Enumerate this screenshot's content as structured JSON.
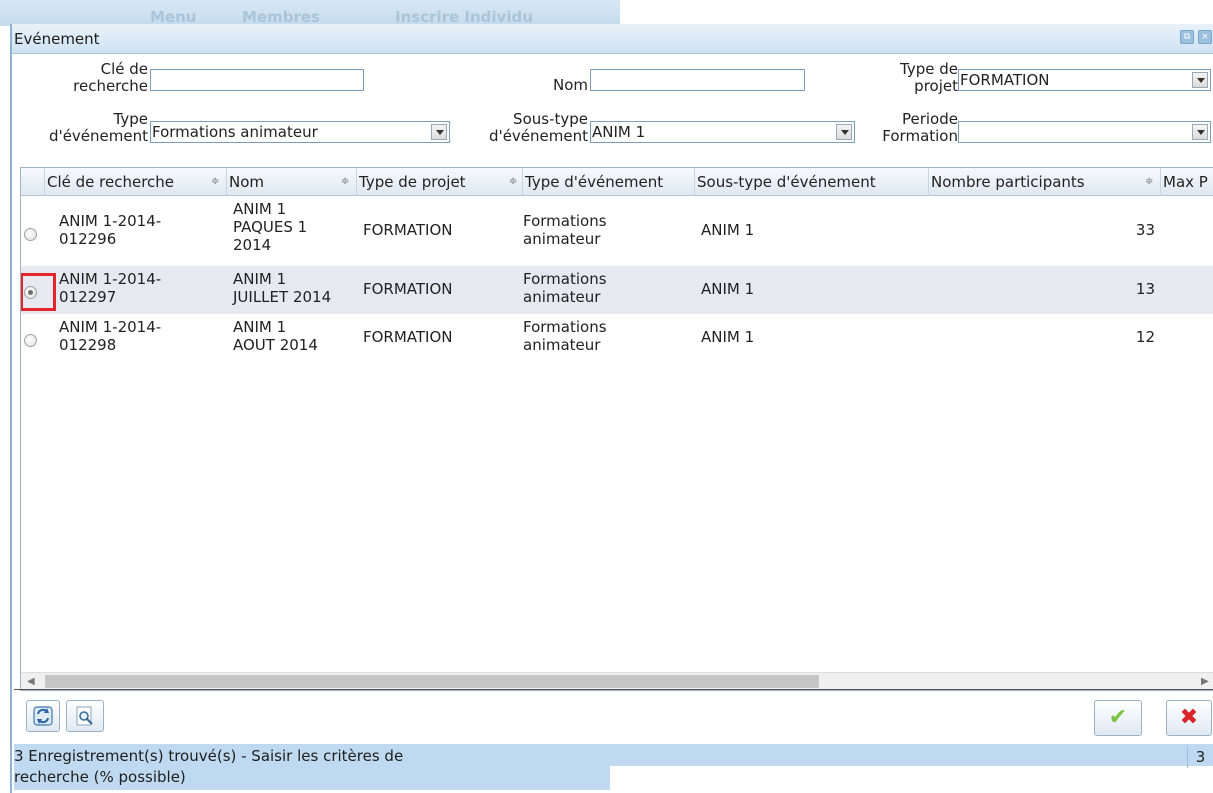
{
  "background_tabs": [
    "Menu",
    "Membres",
    "Inscrire Individu"
  ],
  "window": {
    "title": "Evénement",
    "restore_glyph": "⧉",
    "close_glyph": "×"
  },
  "filters": {
    "cle_label_1": "Clé de",
    "cle_label_2": "recherche",
    "cle_value": "",
    "nom_label": "Nom",
    "nom_value": "",
    "type_projet_label_1": "Type de",
    "type_projet_label_2": "projet",
    "type_projet_value": "FORMATION",
    "type_evt_label_1": "Type",
    "type_evt_label_2": "d'événement",
    "type_evt_value": "Formations animateur",
    "sous_type_label_1": "Sous-type",
    "sous_type_label_2": "d'événement",
    "sous_type_value": "ANIM 1",
    "periode_label_1": "Periode",
    "periode_label_2": "Formation",
    "periode_value": ""
  },
  "grid": {
    "columns": [
      "Clé de recherche",
      "Nom",
      "Type de projet",
      "Type d'événement",
      "Sous-type d'événement",
      "Nombre participants",
      "Max P"
    ],
    "sort_glyph": "≑",
    "rows": [
      {
        "cle_1": "ANIM 1-2014-",
        "cle_2": "012296",
        "nom_1": "ANIM 1",
        "nom_2": "PAQUES 1",
        "nom_3": "2014",
        "type_projet": "FORMATION",
        "type_evt_1": "Formations",
        "type_evt_2": "animateur",
        "sous_type": "ANIM 1",
        "participants": "33",
        "selected": false
      },
      {
        "cle_1": "ANIM 1-2014-",
        "cle_2": "012297",
        "nom_1": "ANIM 1",
        "nom_2": "JUILLET 2014",
        "nom_3": "",
        "type_projet": "FORMATION",
        "type_evt_1": "Formations",
        "type_evt_2": "animateur",
        "sous_type": "ANIM 1",
        "participants": "13",
        "selected": true
      },
      {
        "cle_1": "ANIM 1-2014-",
        "cle_2": "012298",
        "nom_1": "ANIM 1",
        "nom_2": "AOUT 2014",
        "nom_3": "",
        "type_projet": "FORMATION",
        "type_evt_1": "Formations",
        "type_evt_2": "animateur",
        "sous_type": "ANIM 1",
        "participants": "12",
        "selected": false
      }
    ]
  },
  "toolbar": {
    "refresh_icon": "refresh-icon",
    "search_icon": "magnifier-icon",
    "ok_glyph": "✔",
    "cancel_glyph": "✖"
  },
  "status": {
    "line_1": "3 Enregistrement(s) trouvé(s) - Saisir les critères de",
    "line_2": "recherche (% possible)",
    "count": "3"
  },
  "colors": {
    "accent_blue": "#bfdaf0",
    "highlight_red": "#e0252b",
    "ok_green": "#7cc242",
    "cancel_red": "#d8232a"
  }
}
